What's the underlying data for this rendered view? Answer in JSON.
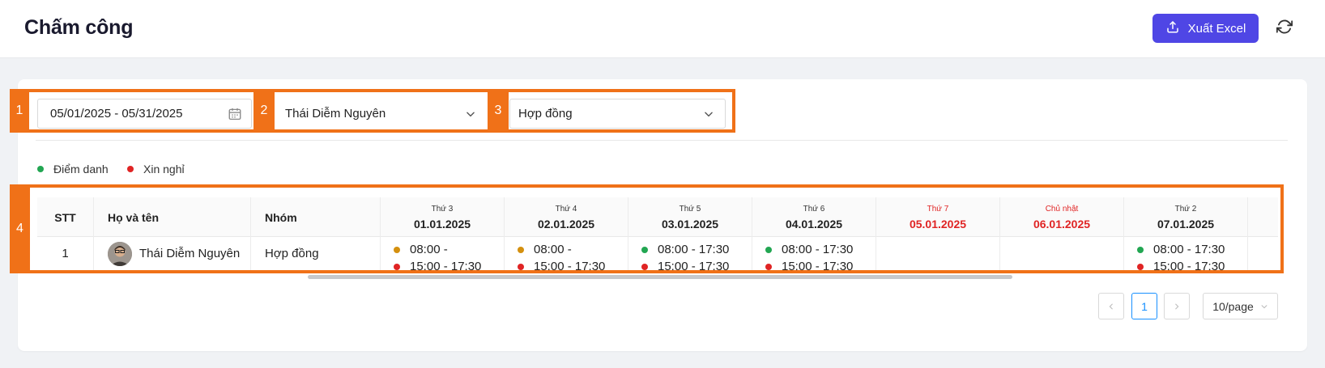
{
  "header": {
    "title": "Chấm công",
    "export_label": "Xuất Excel"
  },
  "filters": {
    "date_range": "05/01/2025 - 05/31/2025",
    "employee": "Thái Diễm Nguyên",
    "group": "Hợp đồng"
  },
  "annotations": [
    "1",
    "2",
    "3",
    "4"
  ],
  "legend": [
    {
      "label": "Điểm danh",
      "color": "#22a652"
    },
    {
      "label": "Xin nghỉ",
      "color": "#e02424"
    }
  ],
  "table": {
    "columns": {
      "stt": "STT",
      "name": "Họ và tên",
      "group": "Nhóm"
    },
    "days": [
      {
        "dow": "Thứ 3",
        "date": "01.01.2025",
        "weekend": false
      },
      {
        "dow": "Thứ 4",
        "date": "02.01.2025",
        "weekend": false
      },
      {
        "dow": "Thứ 5",
        "date": "03.01.2025",
        "weekend": false
      },
      {
        "dow": "Thứ 6",
        "date": "04.01.2025",
        "weekend": false
      },
      {
        "dow": "Thứ 7",
        "date": "05.01.2025",
        "weekend": true
      },
      {
        "dow": "Chủ nhật",
        "date": "06.01.2025",
        "weekend": true
      },
      {
        "dow": "Thứ 2",
        "date": "07.01.2025",
        "weekend": false
      }
    ],
    "rows": [
      {
        "stt": "1",
        "name": "Thái Diễm Nguyên",
        "group": "Hợp đồng",
        "cells": [
          [
            {
              "text": "08:00 -",
              "color": "#d4900f"
            },
            {
              "text": "15:00 - 17:30",
              "color": "#e02424"
            }
          ],
          [
            {
              "text": "08:00 -",
              "color": "#d4900f"
            },
            {
              "text": "15:00 - 17:30",
              "color": "#e02424"
            }
          ],
          [
            {
              "text": "08:00 - 17:30",
              "color": "#22a652"
            },
            {
              "text": "15:00 - 17:30",
              "color": "#e02424"
            }
          ],
          [
            {
              "text": "08:00 - 17:30",
              "color": "#22a652"
            },
            {
              "text": "15:00 - 17:30",
              "color": "#e02424"
            }
          ],
          [],
          [],
          [
            {
              "text": "08:00 - 17:30",
              "color": "#22a652"
            },
            {
              "text": "15:00 - 17:30",
              "color": "#e02424"
            }
          ]
        ]
      }
    ]
  },
  "pagination": {
    "prev_icon": "chevron-left-icon",
    "current_page": "1",
    "next_icon": "chevron-right-icon",
    "page_size": "10/page"
  },
  "colors": {
    "accent": "#4f46e5",
    "highlight": "#f07118",
    "weekend": "#e02424"
  }
}
